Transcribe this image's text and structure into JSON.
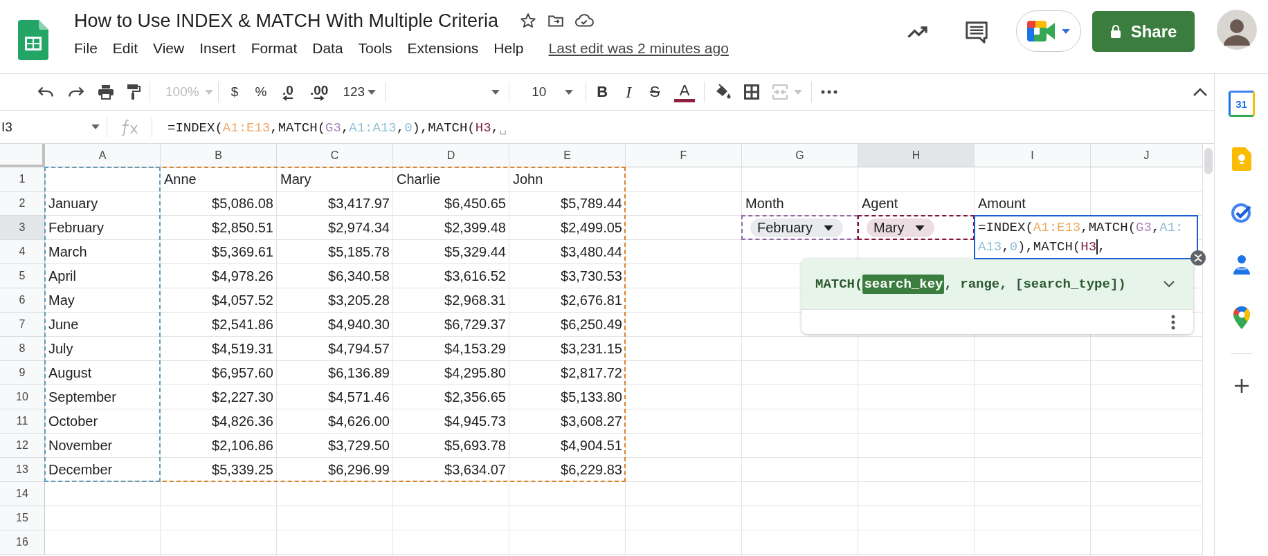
{
  "header": {
    "title": "How to Use INDEX & MATCH With Multiple Criteria",
    "menu": [
      {
        "label": "File"
      },
      {
        "label": "Edit"
      },
      {
        "label": "View"
      },
      {
        "label": "Insert"
      },
      {
        "label": "Format"
      },
      {
        "label": "Data"
      },
      {
        "label": "Tools"
      },
      {
        "label": "Extensions"
      },
      {
        "label": "Help"
      }
    ],
    "last_edit": "Last edit was 2 minutes ago",
    "share_button": "Share"
  },
  "toolbar": {
    "zoom": {
      "text": "100%",
      "disabled": true
    },
    "currency": "$",
    "percent": "%",
    "decrease_decimals": ".0",
    "increase_decimals": ".00",
    "number_format": "123",
    "font_size": "10",
    "bold": "B",
    "italic": "I",
    "strikethrough": "S",
    "text_color": {
      "label": "A",
      "color": "#8e1f3f"
    },
    "merge_cells": {
      "disabled": true
    }
  },
  "formula_bar": {
    "name_box": "I3",
    "tokens": [
      {
        "text": "=INDEX("
      },
      {
        "text": "A1:E13",
        "color": "#eea861"
      },
      {
        "text": ",MATCH("
      },
      {
        "text": "G3",
        "color": "#a987b8"
      },
      {
        "text": ","
      },
      {
        "text": "A1:A13",
        "color": "#8cbdd8"
      },
      {
        "text": ","
      },
      {
        "text": "0",
        "color": "#8cbdd8"
      },
      {
        "text": "),MATCH("
      },
      {
        "text": "H3",
        "color": "#7d2141"
      },
      {
        "text": ","
      },
      {
        "text": "␣",
        "color": "#b8b8b8"
      }
    ]
  },
  "grid": {
    "columns": [
      {
        "label": "A",
        "selected": false
      },
      {
        "label": "B",
        "selected": false
      },
      {
        "label": "C",
        "selected": false
      },
      {
        "label": "D",
        "selected": false
      },
      {
        "label": "E",
        "selected": false
      },
      {
        "label": "F",
        "selected": false
      },
      {
        "label": "G",
        "selected": false
      },
      {
        "label": "H",
        "selected": true
      },
      {
        "label": "I",
        "selected": false
      },
      {
        "label": "J",
        "selected": false
      }
    ],
    "rows": [
      {
        "label": "1",
        "selected": false,
        "cells": [
          null,
          "Anne",
          "Mary",
          "Charlie",
          "John"
        ]
      },
      {
        "label": "2",
        "selected": false,
        "cells": [
          "January",
          {
            "kind": "number",
            "text": "$5,086.08"
          },
          {
            "kind": "number",
            "text": "$3,417.97"
          },
          {
            "kind": "number",
            "text": "$6,450.65"
          },
          {
            "kind": "number",
            "text": "$5,789.44"
          },
          null,
          "Month",
          "Agent",
          "Amount"
        ]
      },
      {
        "label": "3",
        "selected": true,
        "cells": [
          "February",
          {
            "kind": "number",
            "text": "$2,850.51"
          },
          {
            "kind": "number",
            "text": "$2,974.34"
          },
          {
            "kind": "number",
            "text": "$2,399.48"
          },
          {
            "kind": "number",
            "text": "$2,499.05"
          },
          null,
          {
            "kind": "chip",
            "text": "February",
            "color": "#e8eaed"
          },
          {
            "kind": "chip",
            "text": "Mary",
            "color": "#ecdde1"
          }
        ]
      },
      {
        "label": "4",
        "selected": false,
        "cells": [
          "March",
          {
            "kind": "number",
            "text": "$5,369.61"
          },
          {
            "kind": "number",
            "text": "$5,185.78"
          },
          {
            "kind": "number",
            "text": "$5,329.44"
          },
          {
            "kind": "number",
            "text": "$3,480.44"
          }
        ]
      },
      {
        "label": "5",
        "selected": false,
        "cells": [
          "April",
          {
            "kind": "number",
            "text": "$4,978.26"
          },
          {
            "kind": "number",
            "text": "$6,340.58"
          },
          {
            "kind": "number",
            "text": "$3,616.52"
          },
          {
            "kind": "number",
            "text": "$3,730.53"
          }
        ]
      },
      {
        "label": "6",
        "selected": false,
        "cells": [
          "May",
          {
            "kind": "number",
            "text": "$4,057.52"
          },
          {
            "kind": "number",
            "text": "$3,205.28"
          },
          {
            "kind": "number",
            "text": "$2,968.31"
          },
          {
            "kind": "number",
            "text": "$2,676.81"
          }
        ]
      },
      {
        "label": "7",
        "selected": false,
        "cells": [
          "June",
          {
            "kind": "number",
            "text": "$2,541.86"
          },
          {
            "kind": "number",
            "text": "$4,940.30"
          },
          {
            "kind": "number",
            "text": "$6,729.37"
          },
          {
            "kind": "number",
            "text": "$6,250.49"
          }
        ]
      },
      {
        "label": "8",
        "selected": false,
        "cells": [
          "July",
          {
            "kind": "number",
            "text": "$4,519.31"
          },
          {
            "kind": "number",
            "text": "$4,794.57"
          },
          {
            "kind": "number",
            "text": "$4,153.29"
          },
          {
            "kind": "number",
            "text": "$3,231.15"
          }
        ]
      },
      {
        "label": "9",
        "selected": false,
        "cells": [
          "August",
          {
            "kind": "number",
            "text": "$6,957.60"
          },
          {
            "kind": "number",
            "text": "$6,136.89"
          },
          {
            "kind": "number",
            "text": "$4,295.80"
          },
          {
            "kind": "number",
            "text": "$2,817.72"
          }
        ]
      },
      {
        "label": "10",
        "selected": false,
        "cells": [
          "September",
          {
            "kind": "number",
            "text": "$2,227.30"
          },
          {
            "kind": "number",
            "text": "$4,571.46"
          },
          {
            "kind": "number",
            "text": "$2,356.65"
          },
          {
            "kind": "number",
            "text": "$5,133.80"
          }
        ]
      },
      {
        "label": "11",
        "selected": false,
        "cells": [
          "October",
          {
            "kind": "number",
            "text": "$4,826.36"
          },
          {
            "kind": "number",
            "text": "$4,626.00"
          },
          {
            "kind": "number",
            "text": "$4,945.73"
          },
          {
            "kind": "number",
            "text": "$3,608.27"
          }
        ]
      },
      {
        "label": "12",
        "selected": false,
        "cells": [
          "November",
          {
            "kind": "number",
            "text": "$2,106.86"
          },
          {
            "kind": "number",
            "text": "$3,729.50"
          },
          {
            "kind": "number",
            "text": "$5,693.78"
          },
          {
            "kind": "number",
            "text": "$4,904.51"
          }
        ]
      },
      {
        "label": "13",
        "selected": false,
        "cells": [
          "December",
          {
            "kind": "number",
            "text": "$5,339.25"
          },
          {
            "kind": "number",
            "text": "$6,296.99"
          },
          {
            "kind": "number",
            "text": "$3,634.07"
          },
          {
            "kind": "number",
            "text": "$6,229.83"
          }
        ]
      },
      {
        "label": "14",
        "selected": false,
        "cells": []
      },
      {
        "label": "15",
        "selected": false,
        "cells": []
      },
      {
        "label": "16",
        "selected": false,
        "cells": []
      }
    ]
  },
  "cell_editor": {
    "lines": [
      [
        {
          "text": "=INDEX("
        },
        {
          "text": "A1:E13",
          "color": "#eea861"
        },
        {
          "text": ",MATCH("
        },
        {
          "text": "G3",
          "color": "#a987b8"
        },
        {
          "text": ","
        },
        {
          "text": "A1:",
          "color": "#8cbdd8"
        }
      ],
      [
        {
          "text": "A13",
          "color": "#8cbdd8"
        },
        {
          "text": ","
        },
        {
          "text": "0",
          "color": "#8cbdd8"
        },
        {
          "text": "),MATCH("
        },
        {
          "text": "H3",
          "color": "#7d2141"
        },
        {
          "text": ","
        }
      ]
    ]
  },
  "function_hint": {
    "signature": [
      {
        "text": "MATCH(",
        "highlighted": false
      },
      {
        "text": "search_key",
        "highlighted": true
      },
      {
        "text": ", range, [search_type])",
        "highlighted": false
      }
    ]
  },
  "side_panel": {
    "calendar_day": "31"
  }
}
